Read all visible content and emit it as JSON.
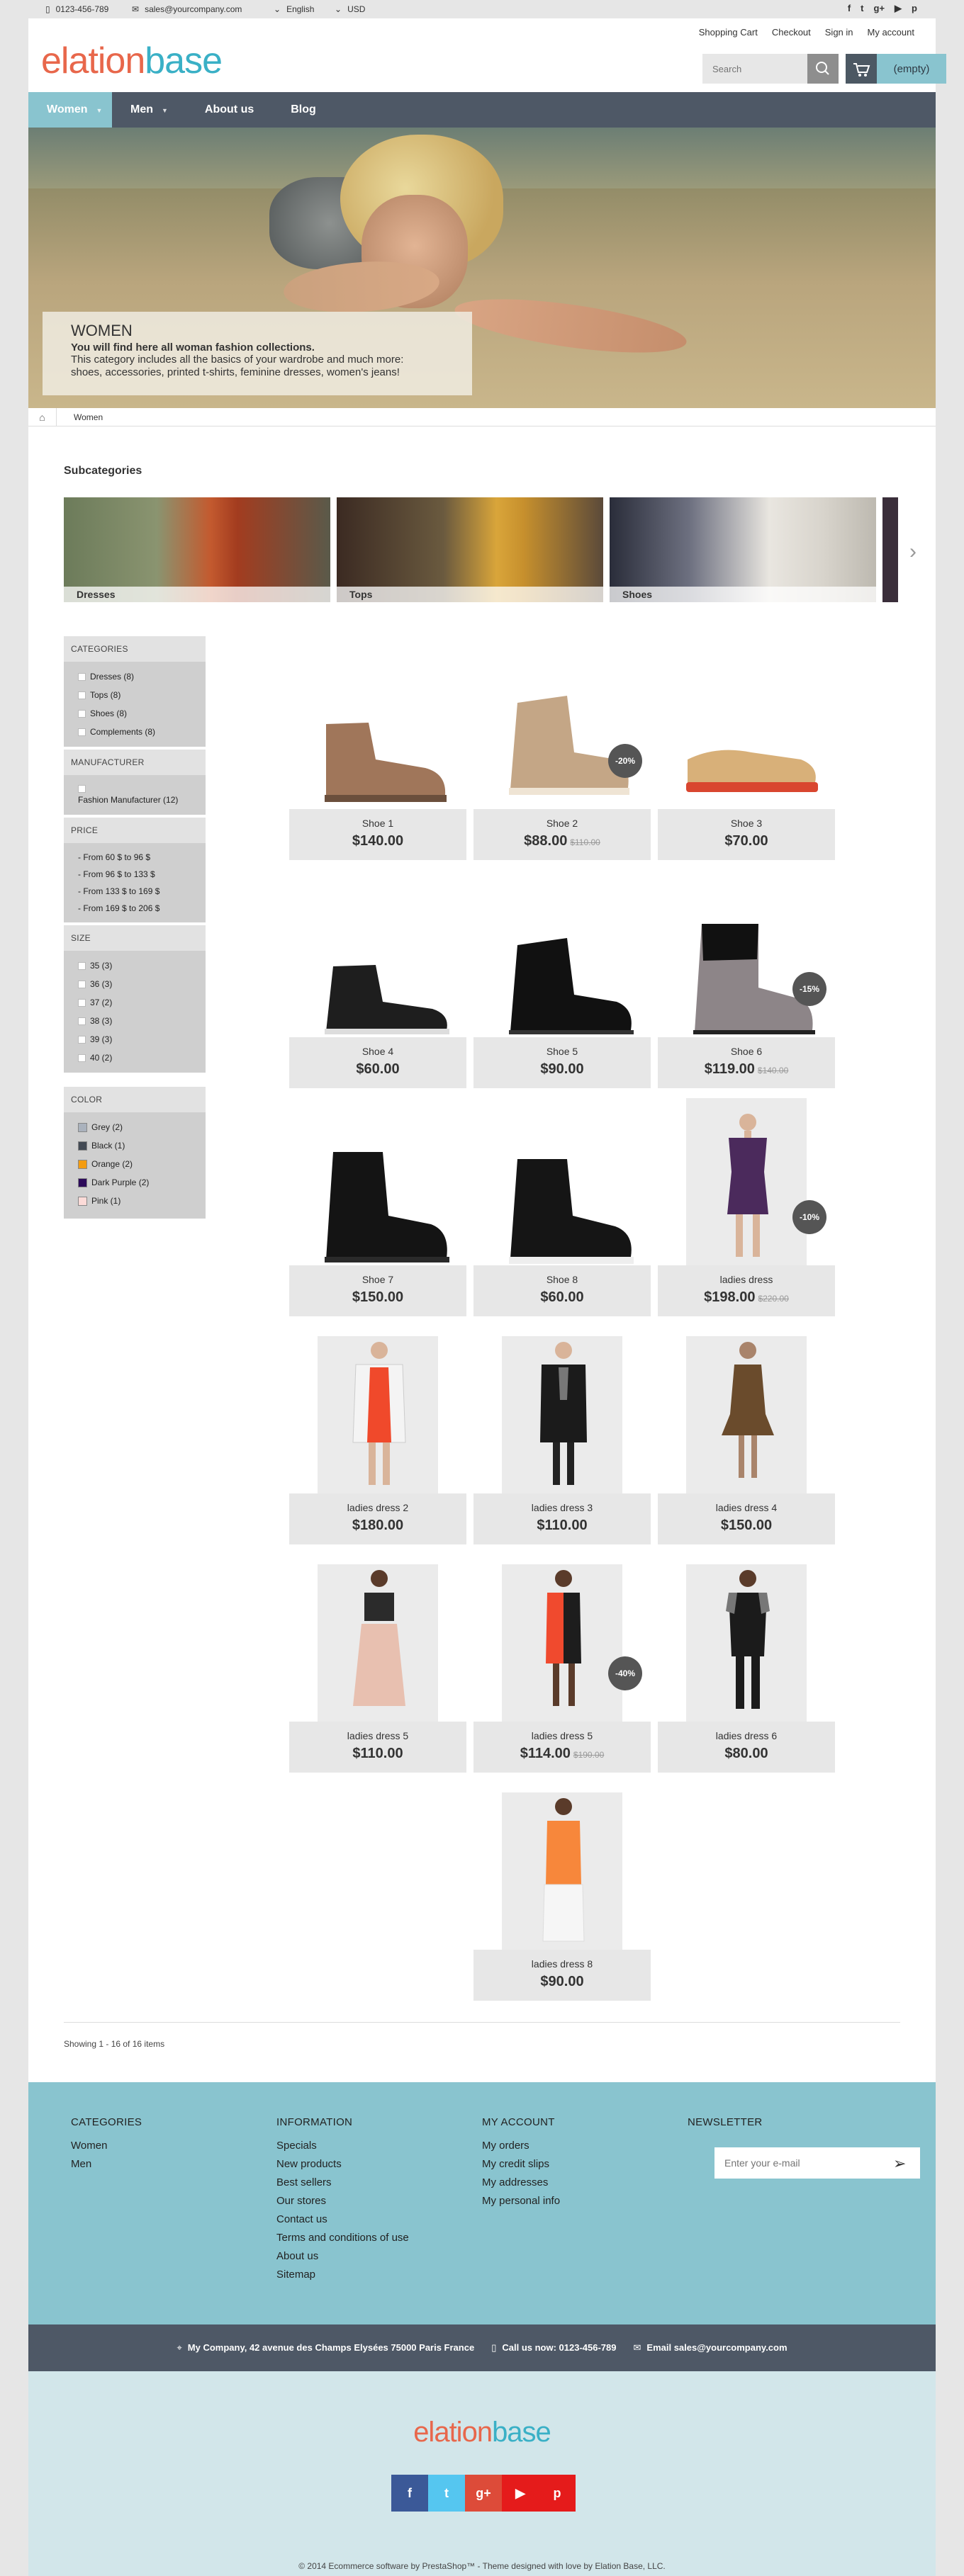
{
  "topbar": {
    "phone": "0123-456-789",
    "email": "sales@yourcompany.com",
    "language": "English",
    "currency": "USD",
    "social": [
      "f",
      "t",
      "g+",
      "▶",
      "p"
    ]
  },
  "header": {
    "logo_part1": "elation",
    "logo_part2": "base",
    "links": [
      "Shopping Cart",
      "Checkout",
      "Sign in",
      "My account"
    ],
    "search_placeholder": "Search",
    "cart_label": "(empty)"
  },
  "nav": {
    "items": [
      "Women",
      "Men",
      "About us",
      "Blog"
    ]
  },
  "banner": {
    "title": "WOMEN",
    "line1": "You will find here all woman fashion collections.",
    "line2": "This category includes all the basics of your wardrobe and much more:",
    "line3": "shoes, accessories, printed t-shirts, feminine dresses, women's jeans!"
  },
  "breadcrumb": {
    "current": "Women"
  },
  "subcategories": {
    "title": "Subcategories",
    "items": [
      "Dresses",
      "Tops",
      "Shoes"
    ]
  },
  "filters": {
    "categories": {
      "title": "CATEGORIES",
      "items": [
        "Dresses (8)",
        "Tops (8)",
        "Shoes (8)",
        "Complements (8)"
      ]
    },
    "manufacturer": {
      "title": "MANUFACTURER",
      "items": [
        "Fashion Manufacturer (12)"
      ]
    },
    "price": {
      "title": "PRICE",
      "items": [
        "- From 60 $ to 96 $",
        "- From 96 $ to 133 $",
        "- From 133 $ to 169 $",
        "- From 169 $ to 206 $"
      ]
    },
    "size": {
      "title": "SIZE",
      "items": [
        "35 (3)",
        "36 (3)",
        "37 (2)",
        "38 (3)",
        "39 (3)",
        "40 (2)"
      ]
    },
    "color": {
      "title": "COLOR",
      "items": [
        {
          "label": "Grey (2)",
          "color": "#aab2bd"
        },
        {
          "label": "Black (1)",
          "color": "#434a54"
        },
        {
          "label": "Orange (2)",
          "color": "#f39c11"
        },
        {
          "label": "Dark Purple (2)",
          "color": "#2d0b5a"
        },
        {
          "label": "Pink (1)",
          "color": "#fcdbd8"
        }
      ]
    }
  },
  "products": [
    {
      "name": "Shoe 1",
      "price": "$140.00",
      "old": "",
      "badge": ""
    },
    {
      "name": "Shoe 2",
      "price": "$88.00",
      "old": "$110.00",
      "badge": "-20%"
    },
    {
      "name": "Shoe 3",
      "price": "$70.00",
      "old": "",
      "badge": ""
    },
    {
      "name": "Shoe 4",
      "price": "$60.00",
      "old": "",
      "badge": ""
    },
    {
      "name": "Shoe 5",
      "price": "$90.00",
      "old": "",
      "badge": ""
    },
    {
      "name": "Shoe 6",
      "price": "$119.00",
      "old": "$140.00",
      "badge": "-15%"
    },
    {
      "name": "Shoe 7",
      "price": "$150.00",
      "old": "",
      "badge": ""
    },
    {
      "name": "Shoe 8",
      "price": "$60.00",
      "old": "",
      "badge": ""
    },
    {
      "name": "ladies dress",
      "price": "$198.00",
      "old": "$220.00",
      "badge": "-10%"
    },
    {
      "name": "ladies dress 2",
      "price": "$180.00",
      "old": "",
      "badge": ""
    },
    {
      "name": "ladies dress 3",
      "price": "$110.00",
      "old": "",
      "badge": ""
    },
    {
      "name": "ladies dress 4",
      "price": "$150.00",
      "old": "",
      "badge": ""
    },
    {
      "name": "ladies dress 5",
      "price": "$110.00",
      "old": "",
      "badge": ""
    },
    {
      "name": "ladies dress 5",
      "price": "$114.00",
      "old": "$190.00",
      "badge": "-40%"
    },
    {
      "name": "ladies dress 6",
      "price": "$80.00",
      "old": "",
      "badge": ""
    },
    {
      "name": "ladies dress 8",
      "price": "$90.00",
      "old": "",
      "badge": ""
    }
  ],
  "pagination": {
    "showing": "Showing 1 - 16 of 16 items"
  },
  "footer": {
    "categories": {
      "title": "CATEGORIES",
      "items": [
        "Women",
        "Men"
      ]
    },
    "information": {
      "title": "INFORMATION",
      "items": [
        "Specials",
        "New products",
        "Best sellers",
        "Our stores",
        "Contact us",
        "Terms and conditions of use",
        "About us",
        "Sitemap"
      ]
    },
    "account": {
      "title": "MY ACCOUNT",
      "items": [
        "My orders",
        "My credit slips",
        "My addresses",
        "My personal info"
      ]
    },
    "newsletter": {
      "title": "NEWSLETTER",
      "placeholder": "Enter your e-mail"
    },
    "address": "My Company, 42 avenue des Champs Elysées 75000 Paris France",
    "call": "Call us now: 0123-456-789",
    "email": "Email sales@yourcompany.com",
    "social": [
      "f",
      "t",
      "g+",
      "▶",
      "p"
    ],
    "copyright": "© 2014 Ecommerce software by PrestaShop™ - Theme designed with love by Elation Base, LLC."
  },
  "colors": {
    "accent": "#89c4cf",
    "dark": "#4e5866",
    "logo_orange": "#e8674b",
    "logo_blue": "#3ab0c6"
  }
}
